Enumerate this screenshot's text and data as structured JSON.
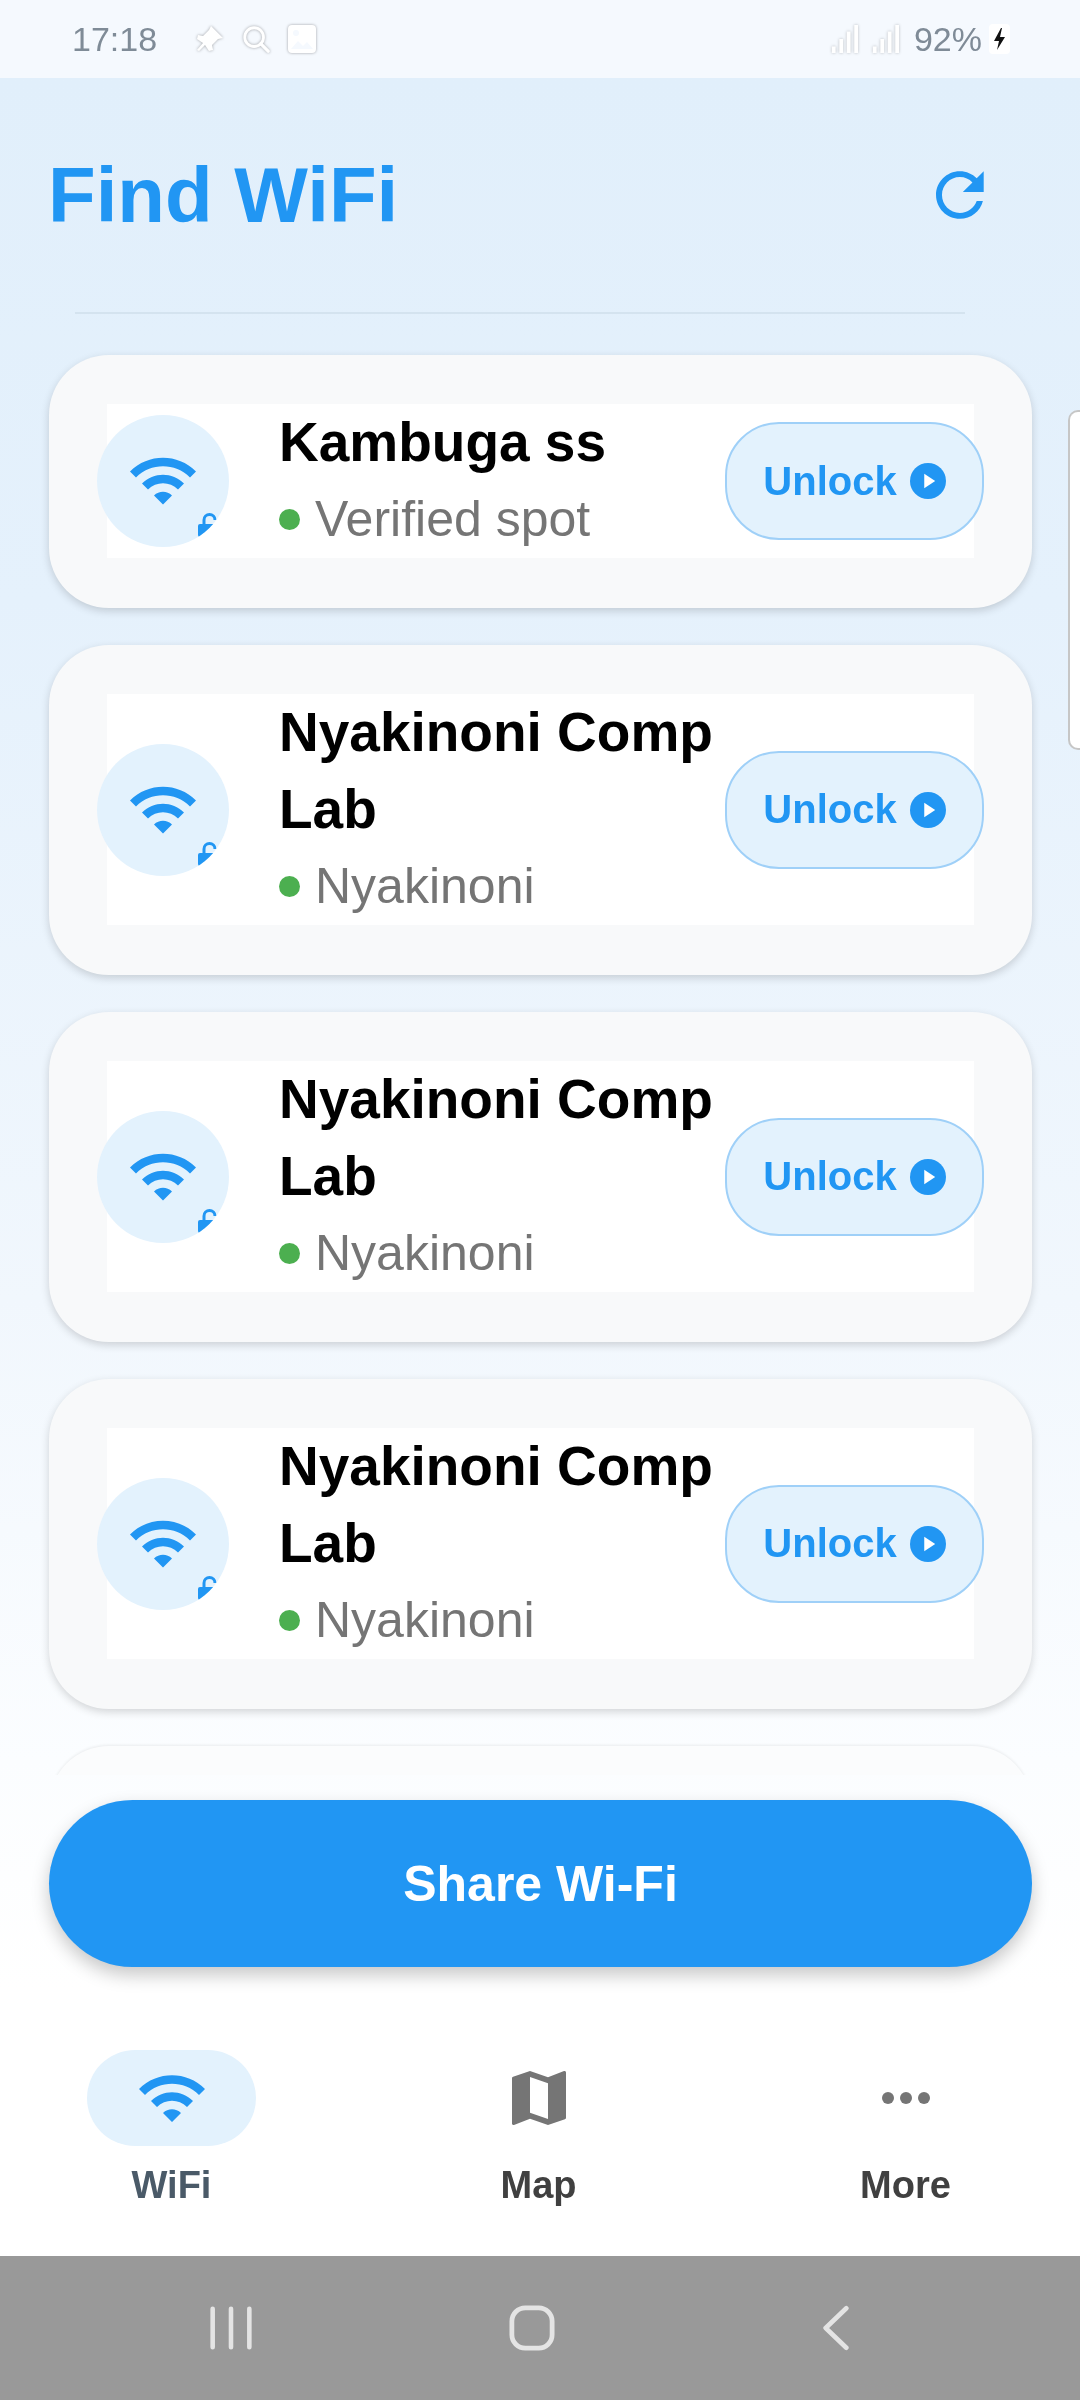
{
  "status_bar": {
    "time": "17:18",
    "battery": "92%"
  },
  "header": {
    "title": "Find WiFi"
  },
  "networks": [
    {
      "name": "Kambuga ss",
      "location": "Verified spot",
      "color": "#4caf50",
      "action": "Unlock"
    },
    {
      "name": "Nyakinoni Comp Lab",
      "location": "Nyakinoni",
      "color": "#4caf50",
      "action": "Unlock"
    },
    {
      "name": "Nyakinoni Comp Lab",
      "location": "Nyakinoni",
      "color": "#4caf50",
      "action": "Unlock"
    },
    {
      "name": "Nyakinoni Comp Lab",
      "location": "Nyakinoni",
      "color": "#4caf50",
      "action": "Unlock"
    }
  ],
  "share_button": {
    "label": "Share Wi-Fi"
  },
  "bottom_nav": [
    {
      "label": "WiFi",
      "selected": true
    },
    {
      "label": "Map",
      "selected": false
    },
    {
      "label": "More",
      "selected": false
    }
  ]
}
